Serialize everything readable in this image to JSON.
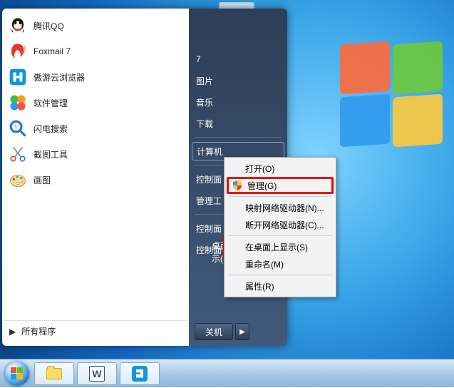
{
  "programs": [
    {
      "label": "腾讯QQ",
      "icon": "qq-icon"
    },
    {
      "label": "Foxmail 7",
      "icon": "foxmail-icon"
    },
    {
      "label": "傲游云浏览器",
      "icon": "maxthon-icon"
    },
    {
      "label": "软件管理",
      "icon": "software-manager-icon"
    },
    {
      "label": "闪电搜索",
      "icon": "lightning-search-icon"
    },
    {
      "label": "截图工具",
      "icon": "snipping-tool-icon"
    },
    {
      "label": "画图",
      "icon": "paint-icon"
    }
  ],
  "all_programs": "所有程序",
  "right_panel": {
    "items": [
      "7",
      "图片",
      "音乐",
      "下载"
    ],
    "computer": "计算机",
    "control": "控制面",
    "manage": "管理工",
    "ctrl2": "控制面",
    "ctrl3": "控制面"
  },
  "hidden": {
    "desktop": "桌面",
    "show_label": "示(S)"
  },
  "shutdown": "关机",
  "context_menu": {
    "open": "打开(O)",
    "manage": "管理(G)",
    "map_drive": "映射网络驱动器(N)...",
    "disconnect_drive": "断开网络驱动器(C)...",
    "show_on_desktop": "在桌面上显示(S)",
    "rename": "重命名(M)",
    "properties": "属性(R)"
  },
  "taskbar": {
    "explorer": "文件资源管理器",
    "word": "W",
    "maxthon": "傲游"
  }
}
